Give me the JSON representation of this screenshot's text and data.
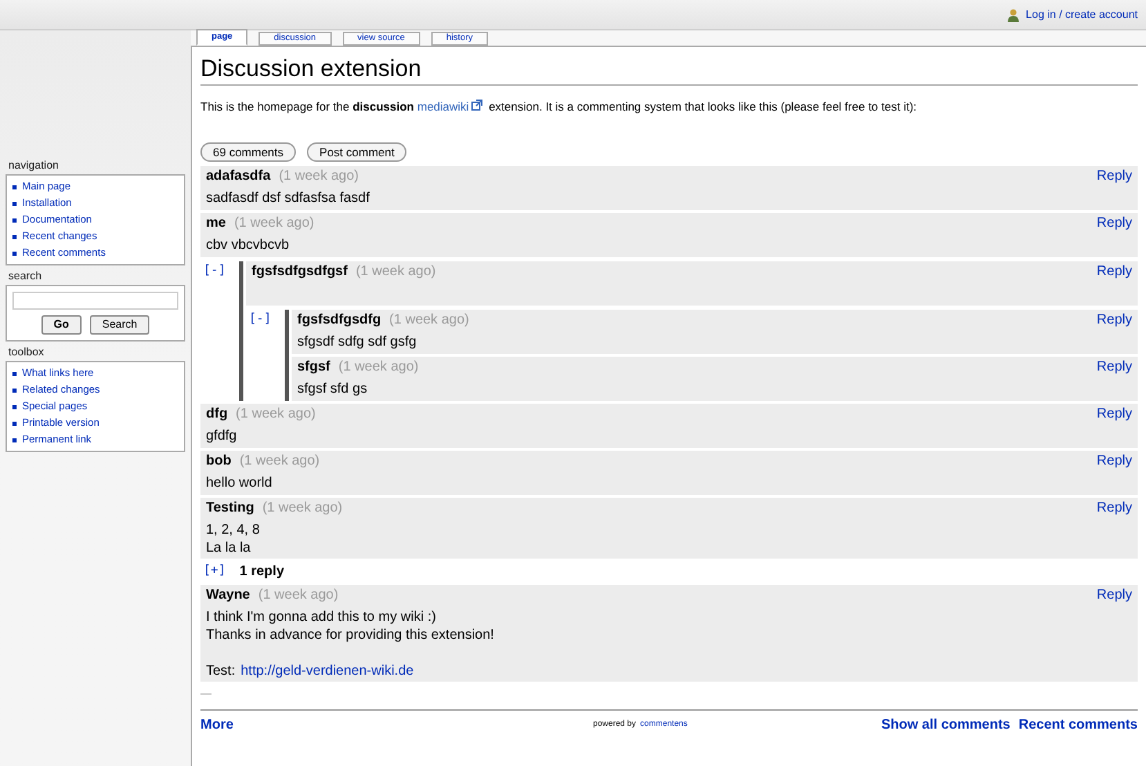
{
  "user_link": "Log in / create account",
  "tabs": [
    {
      "label": "page",
      "selected": true
    },
    {
      "label": "discussion",
      "selected": false
    },
    {
      "label": "view source",
      "selected": false
    },
    {
      "label": "history",
      "selected": false
    }
  ],
  "title": "Discussion extension",
  "intro": {
    "before": "This is the homepage for the **discussion**",
    "link": "mediawiki",
    "after": "extension. It is a commenting system that looks like this (please feel free to test it):"
  },
  "sidebar": [
    {
      "kind": "links",
      "heading": "navigation",
      "items": [
        "Main page",
        "Installation",
        "Documentation",
        "Recent changes",
        "Recent comments"
      ]
    },
    {
      "kind": "search",
      "heading": "search",
      "buttons": [
        "Go",
        "Search"
      ]
    },
    {
      "kind": "links",
      "heading": "toolbox",
      "items": [
        "What links here",
        "Related changes",
        "Special pages",
        "Printable version",
        "Permanent link"
      ]
    }
  ],
  "toolbar": [
    "69 comments",
    "Post comment"
  ],
  "comments": [
    {
      "author": "adafasdfa",
      "time": "(1 week ago)",
      "reply": "Reply",
      "lines": [
        "sadfasdf dsf sdfasfsa fasdf"
      ]
    },
    {
      "author": "me",
      "time": "(1 week ago)",
      "reply": "Reply",
      "lines": [
        "cbv vbcvbcvb"
      ],
      "thread": {
        "expanded": true,
        "toggle": "[-]",
        "children": [
          {
            "author": "fgsfsdfgsdfgsf",
            "time": "(1 week ago)",
            "reply": "Reply",
            "thread": {
              "expanded": true,
              "toggle": "[-]",
              "children": [
                {
                  "author": "fgsfsdfgsdfg",
                  "time": "(1 week ago)",
                  "reply": "Reply",
                  "lines": [
                    "sfgsdf sdfg sdf gsfg"
                  ]
                },
                {
                  "author": "sfgsf",
                  "time": "(1 week ago)",
                  "reply": "Reply",
                  "lines": [
                    "sfgsf sfd gs"
                  ]
                }
              ]
            }
          }
        ]
      }
    },
    {
      "author": "dfg",
      "time": "(1 week ago)",
      "reply": "Reply",
      "lines": [
        "gfdfg"
      ]
    },
    {
      "author": "bob",
      "time": "(1 week ago)",
      "reply": "Reply",
      "lines": [
        "hello world"
      ]
    },
    {
      "author": "Testing",
      "time": "(1 week ago)",
      "reply": "Reply",
      "lines": [
        "1, 2, 4, 8",
        "La la la"
      ],
      "thread": {
        "expanded": false,
        "toggle": "[+]",
        "count": "1 reply"
      }
    },
    {
      "author": "Wayne",
      "time": "(1 week ago)",
      "reply": "Reply",
      "lines": [
        "I think I'm gonna add this to my wiki :)",
        "Thanks in advance for providing this extension!"
      ],
      "link_line": {
        "label": "Test:",
        "url": "http://geld-verdienen-wiki.de"
      }
    }
  ],
  "end_mark": "—",
  "footer": {
    "more": "More",
    "powered": "powered by",
    "brand": "commentens",
    "links": [
      "Show all comments",
      "Recent comments"
    ]
  }
}
